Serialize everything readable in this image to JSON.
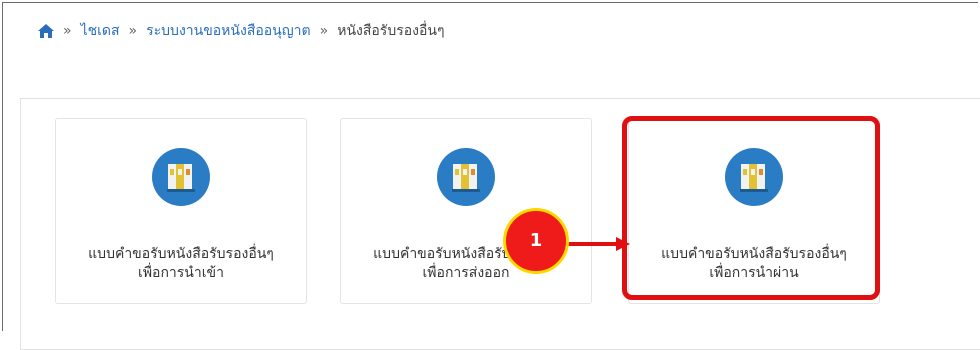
{
  "breadcrumb": {
    "home_icon": "home-icon",
    "separator": "»",
    "items": [
      "ไชเดส",
      "ระบบงานขอหนังสืออนุญาต",
      "หนังสือรับรองอื่นๆ"
    ]
  },
  "cards": [
    {
      "icon": "binders-icon",
      "line1": "แบบคำขอรับหนังสือรับรองอื่นๆ",
      "line2": "เพื่อการนำเข้า"
    },
    {
      "icon": "binders-icon",
      "line1": "แบบคำขอรับหนังสือรับรองอื่นๆ",
      "line2": "เพื่อการส่งออก"
    },
    {
      "icon": "binders-icon",
      "line1": "แบบคำขอรับหนังสือรับรองอื่นๆ",
      "line2": "เพื่อการนำผ่าน"
    }
  ],
  "annotation": {
    "step_number": "1",
    "highlight_color": "#e01010",
    "marker_color": "#ef1a1a",
    "marker_border": "#ffd800"
  },
  "colors": {
    "icon_bg": "#2a7cc4",
    "link": "#2a6ebb"
  }
}
